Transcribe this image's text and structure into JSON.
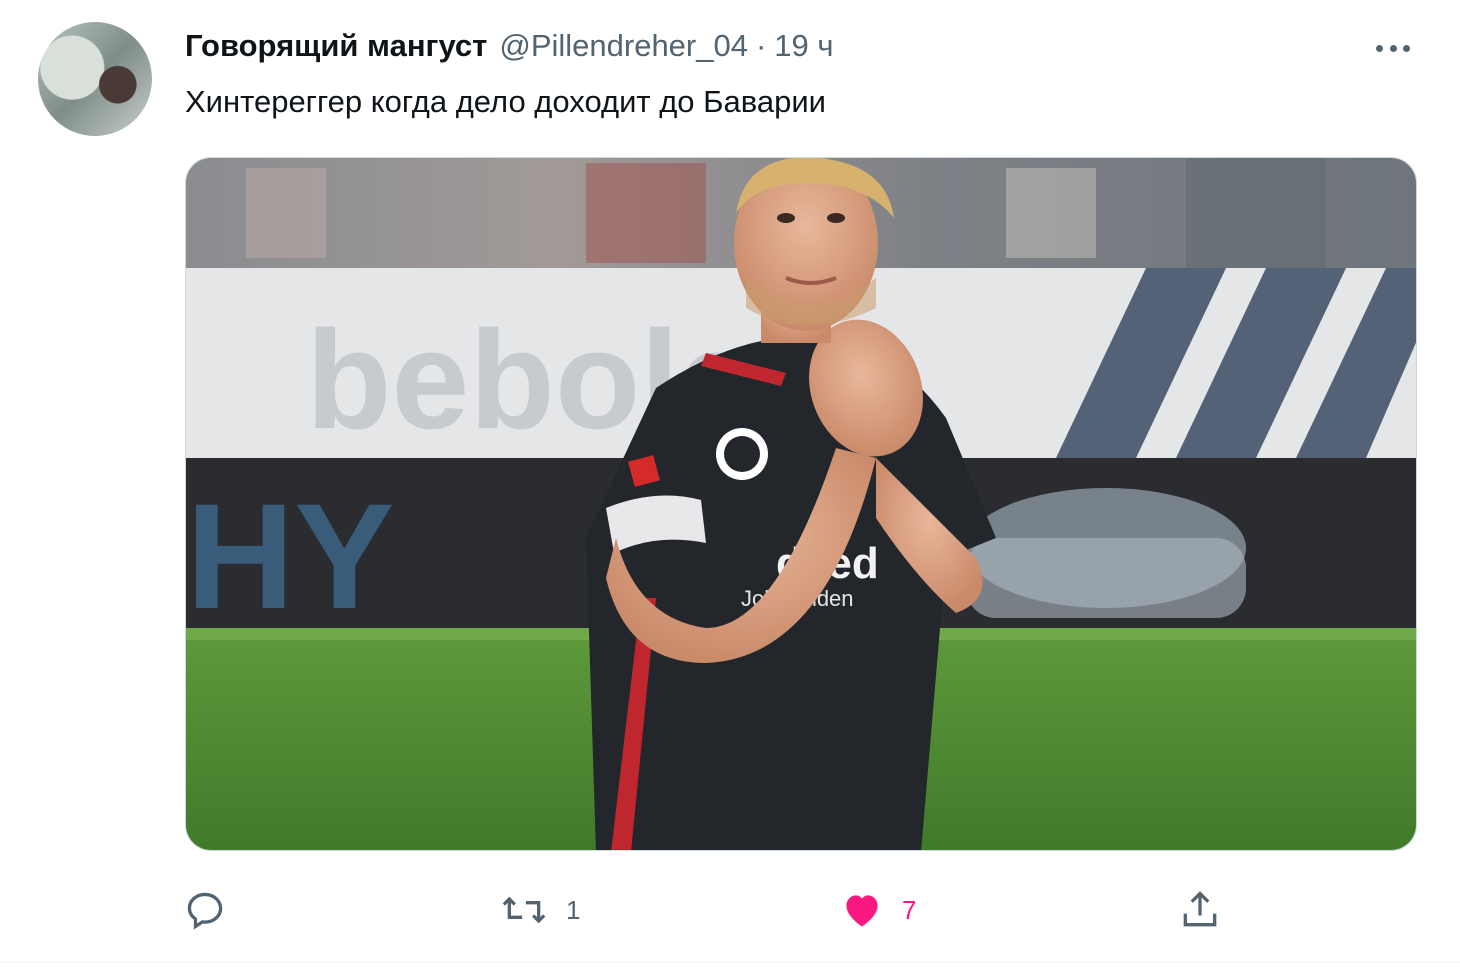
{
  "tweet": {
    "author_name": "Говорящий мангуст",
    "author_handle": "@Pillendreher_04",
    "separator": "·",
    "time": "19 ч",
    "text": "Хинтереггер когда дело доходит до Баварии",
    "media_icon": "photo",
    "more_icon": "more-icon"
  },
  "actions": {
    "reply": {
      "icon": "reply-icon",
      "count": ""
    },
    "retweet": {
      "icon": "retweet-icon",
      "count": "1"
    },
    "like": {
      "icon": "heart-icon",
      "count": "7",
      "liked": true,
      "color": "#f91880"
    },
    "share": {
      "icon": "share-icon",
      "count": ""
    }
  },
  "colors": {
    "text_primary": "#0f1419",
    "text_secondary": "#536471",
    "like_active": "#f91880"
  }
}
